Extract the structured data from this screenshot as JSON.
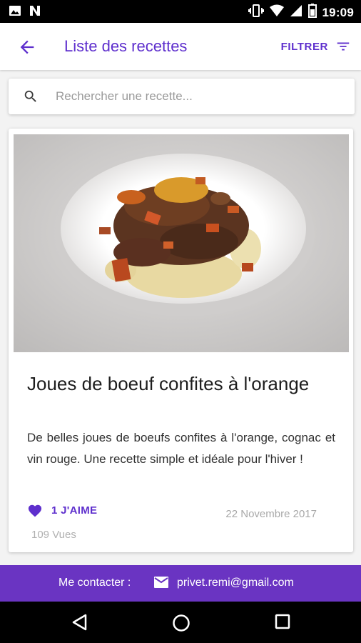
{
  "status_bar": {
    "time": "19:09",
    "icons": [
      "image-icon",
      "n-icon",
      "vibrate-icon",
      "wifi-icon",
      "signal-icon",
      "battery-icon"
    ]
  },
  "app_bar": {
    "title": "Liste des recettes",
    "filter_label": "FILTRER",
    "accent_color": "#5e2fcd"
  },
  "search": {
    "placeholder": "Rechercher une recette...",
    "value": ""
  },
  "recipe": {
    "title": "Joues de boeuf confites à l'orange",
    "description": "De belles joues de boeufs confites à l'orange, cognac et vin rouge. Une recette simple et idéale pour l'hiver !",
    "likes_label": "1 J'AIME",
    "date": "22 Novembre 2017",
    "views": "109 Vues"
  },
  "footer": {
    "contact_label": "Me contacter :",
    "email": "privet.remi@gmail.com",
    "background_color": "#6a34c2"
  },
  "nav_bar": {
    "buttons": [
      "back-triangle-icon",
      "home-circle-icon",
      "recents-square-icon"
    ]
  }
}
